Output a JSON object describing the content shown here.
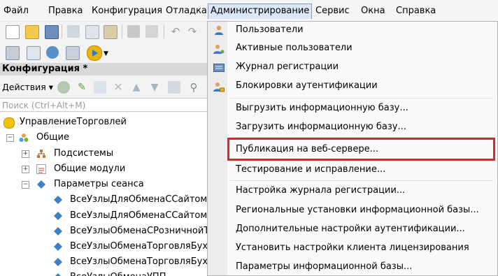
{
  "menubar": {
    "items": [
      "Файл",
      "Правка",
      "Конфигурация",
      "Отладка",
      "Администрирование",
      "Сервис",
      "Окна",
      "Справка"
    ]
  },
  "config_panel": {
    "title": "Конфигурация *",
    "actions_label": "Действия",
    "search_placeholder": "Поиск (Ctrl+Alt+M)"
  },
  "tree": {
    "root": "УправлениеТорговлей",
    "common": "Общие",
    "subsystems": "Подсистемы",
    "common_modules": "Общие модули",
    "session_params": "Параметры сеанса",
    "params": [
      "ВсеУзлыДляОбменаССайтомЗ",
      "ВсеУзлыДляОбменаССайтомТ",
      "ВсеУзлыОбменаСРозничнойТ",
      "ВсеУзлыОбменаТорговляБухг",
      "ВсеУзлыОбменаТорговляБухг",
      "ВсеУзлыОбменаУПП"
    ]
  },
  "admin_menu": {
    "items": [
      "Пользователи",
      "Активные пользователи",
      "Журнал регистрации",
      "Блокировки аутентификации",
      "Выгрузить информационную базу...",
      "Загрузить информационную базу...",
      "Публикация на веб-сервере...",
      "Тестирование и исправление...",
      "Настройка журнала регистрации...",
      "Региональные установки информационной базы...",
      "Дополнительные настройки аутентификации...",
      "Установить настройки клиента лицензирования",
      "Параметры информационной базы..."
    ]
  },
  "colors": {
    "highlight_border": "#e8202a",
    "menu_active_bg": "#dbe7f6"
  }
}
